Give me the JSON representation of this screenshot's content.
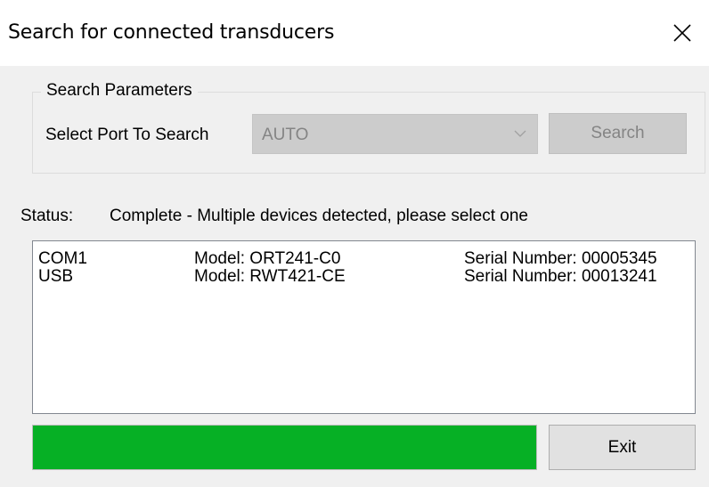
{
  "window": {
    "title": "Search for connected transducers"
  },
  "search_parameters": {
    "legend": "Search Parameters",
    "port_label": "Select Port To Search",
    "port_value": "AUTO",
    "search_label": "Search"
  },
  "status": {
    "label": "Status:",
    "value": "Complete - Multiple devices detected, please select one"
  },
  "devices": [
    {
      "port": "COM1",
      "model": "Model: ORT241-C0",
      "serial": "Serial Number: 00005345"
    },
    {
      "port": "USB",
      "model": "Model: RWT421-CE",
      "serial": "Serial Number: 00013241"
    }
  ],
  "progress": {
    "fraction": 1.0,
    "color": "#06b025"
  },
  "footer": {
    "exit_label": "Exit"
  },
  "icons": {
    "close": "close-icon",
    "dropdown": "chevron-down-icon"
  }
}
